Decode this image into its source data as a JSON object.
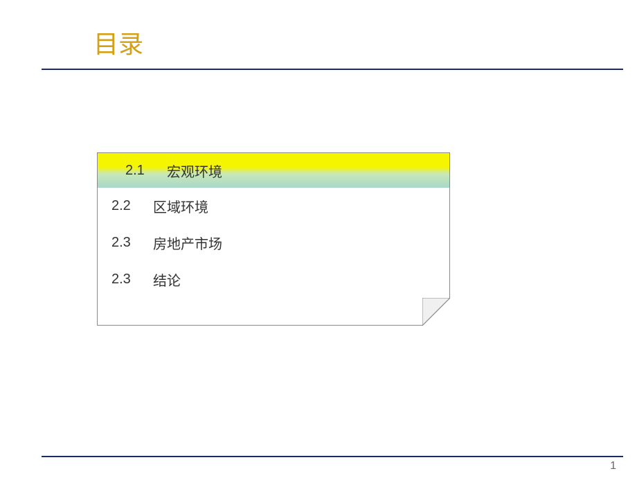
{
  "title": "目录",
  "toc": {
    "items": [
      {
        "number": "2.1",
        "text": "宏观环境",
        "highlighted": true
      },
      {
        "number": "2.2",
        "text": "区域环境",
        "highlighted": false
      },
      {
        "number": "2.3",
        "text": "房地产市场",
        "highlighted": false
      },
      {
        "number": "2.3",
        "text": "结论",
        "highlighted": false
      }
    ]
  },
  "pageNumber": "1"
}
